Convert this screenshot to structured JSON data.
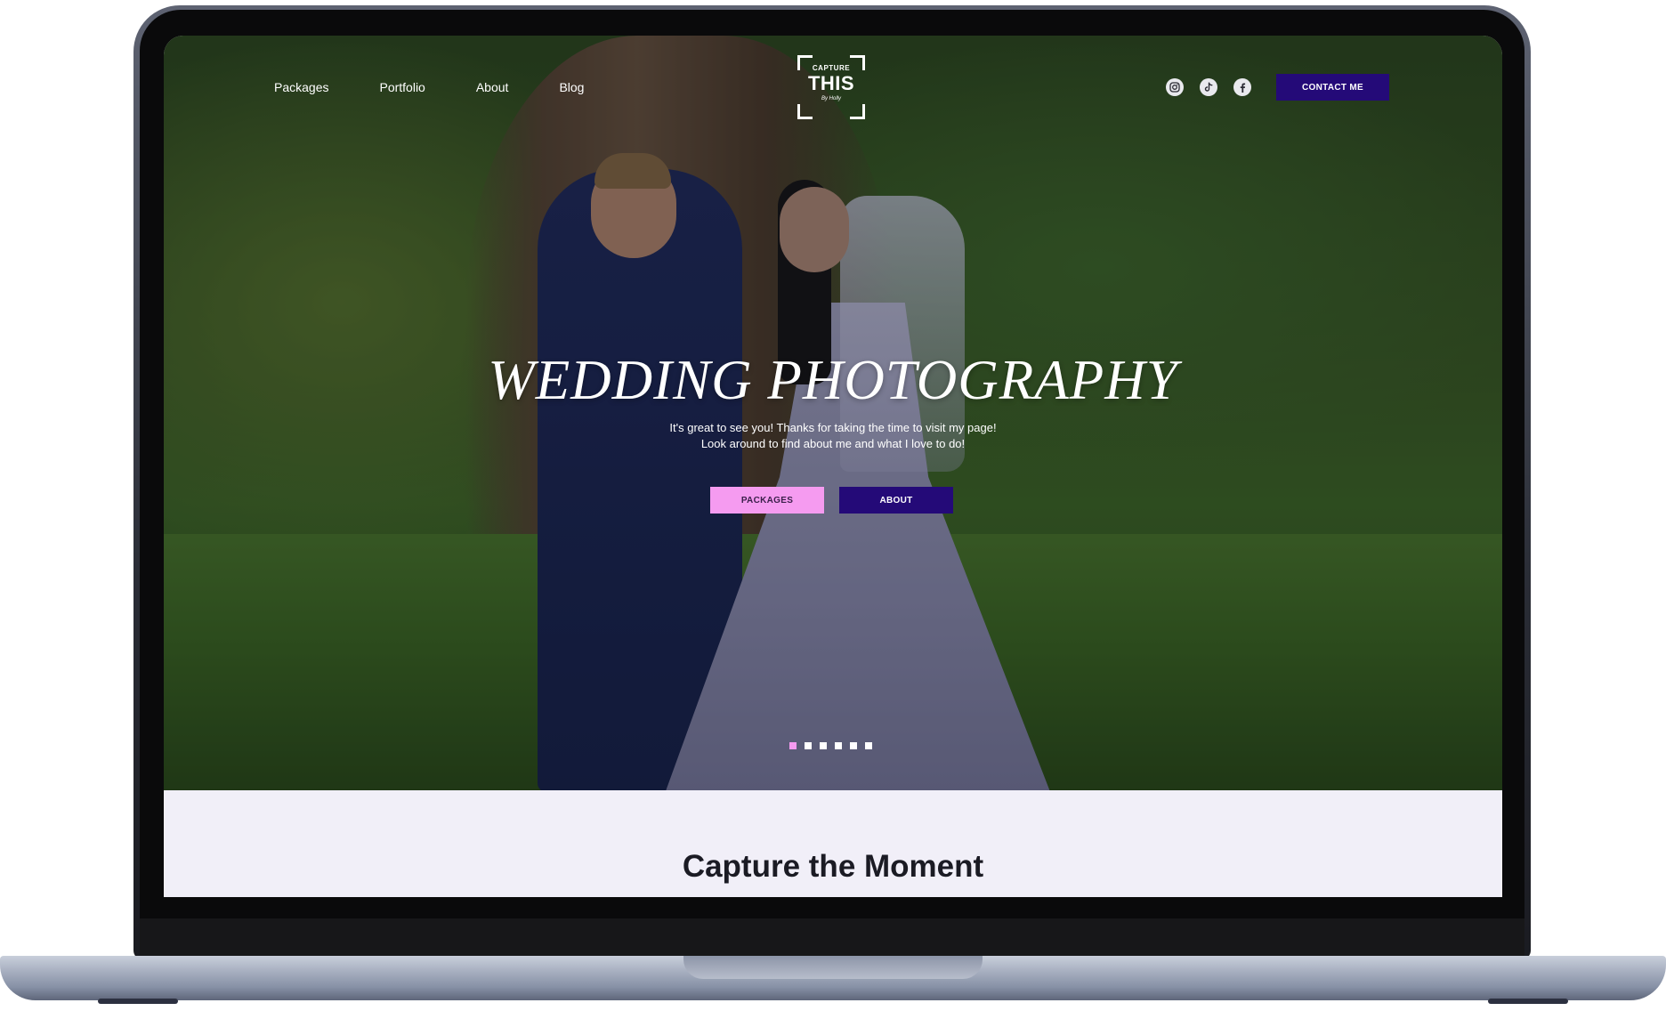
{
  "nav": {
    "links": [
      "Packages",
      "Portfolio",
      "About",
      "Blog"
    ],
    "contact_label": "CONTACT ME",
    "social_icons": [
      "instagram-icon",
      "tiktok-icon",
      "facebook-icon"
    ]
  },
  "logo": {
    "top_text": "CAPTURE",
    "main_text": "THIS",
    "script_text": "By Holly"
  },
  "hero": {
    "title": "WEDDING PHOTOGRAPHY",
    "subtitle_line1": "It's great to see you! Thanks for taking the time to visit my page!",
    "subtitle_line2": "Look around to find about me and what I love to do!",
    "packages_label": "PACKAGES",
    "about_label": "ABOUT",
    "slide_count": 6,
    "active_slide": 1
  },
  "section": {
    "title": "Capture the Moment"
  },
  "colors": {
    "accent_purple": "#240a78",
    "accent_pink": "#f59bf0",
    "section_bg": "#f1eff8"
  }
}
